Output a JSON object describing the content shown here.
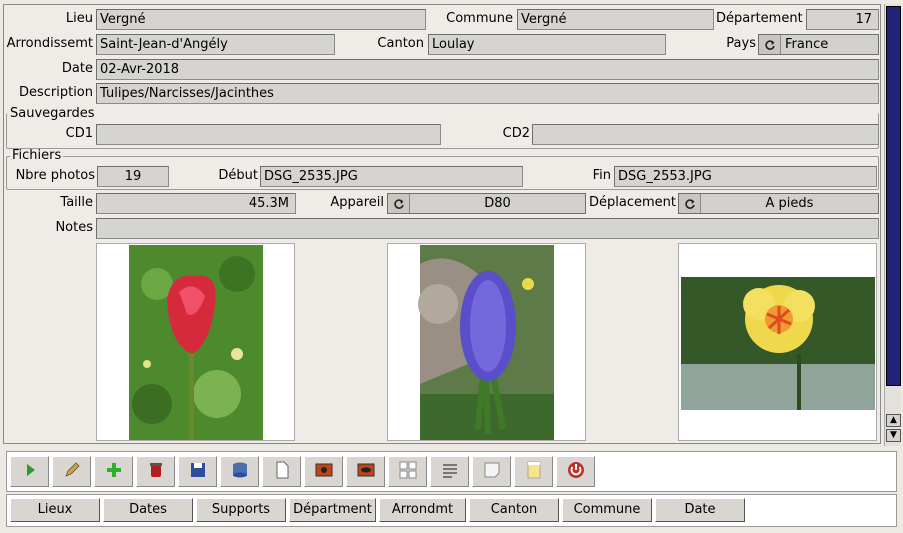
{
  "fields": {
    "lieu_label": "Lieu",
    "lieu": "Vergné",
    "commune_label": "Commune",
    "commune": "Vergné",
    "dept_label": "Département",
    "dept": "17",
    "arr_label": "Arrondissemt",
    "arr": "Saint-Jean-d'Angély",
    "canton_label": "Canton",
    "canton": "Loulay",
    "pays_label": "Pays",
    "pays": "France",
    "date_label": "Date",
    "date": "02-Avr-2018",
    "desc_label": "Description",
    "desc": "Tulipes/Narcisses/Jacinthes",
    "sauv_label": "Sauvegardes",
    "cd1_label": "CD1",
    "cd1": "",
    "cd2_label": "CD2",
    "cd2": "",
    "fichiers_label": "Fichiers",
    "nbre_label": "Nbre photos",
    "nbre": "19",
    "debut_label": "Début",
    "debut": "DSG_2535.JPG",
    "fin_label": "Fin",
    "fin": "DSG_2553.JPG",
    "taille_label": "Taille",
    "taille": "45.3M",
    "appareil_label": "Appareil",
    "appareil": "D80",
    "deplacement_label": "Déplacement",
    "deplacement": "A pieds",
    "notes_label": "Notes",
    "notes": ""
  },
  "photos": [
    {
      "subject": "red tulip"
    },
    {
      "subject": "purple hyacinth"
    },
    {
      "subject": "yellow narcissus"
    }
  ],
  "toolbar": [
    {
      "icon": "play-icon",
      "color": "#2e9a2e"
    },
    {
      "icon": "pencil-icon",
      "color": "#d8a030"
    },
    {
      "icon": "add-icon",
      "color": "#2fae2f"
    },
    {
      "icon": "delete-icon",
      "color": "#b02020"
    },
    {
      "icon": "save-icon",
      "color": "#2c4f9c"
    },
    {
      "icon": "database-icon",
      "color": "#4a6fb0"
    },
    {
      "icon": "new-page-icon",
      "color": "#ffffff"
    },
    {
      "icon": "view-photo-icon",
      "color": "#c0441a"
    },
    {
      "icon": "view-photo-alt-icon",
      "color": "#c0441a"
    },
    {
      "icon": "grid-icon",
      "color": "#888888"
    },
    {
      "icon": "list-icon",
      "color": "#777777"
    },
    {
      "icon": "note-icon",
      "color": "#f4f4f4"
    },
    {
      "icon": "notepad-icon",
      "color": "#f6e58a"
    },
    {
      "icon": "power-icon",
      "color": "#c0302a"
    }
  ],
  "nav": [
    "Lieux",
    "Dates",
    "Supports",
    "Départment",
    "Arrondmt",
    "Canton",
    "Commune",
    "Date"
  ]
}
